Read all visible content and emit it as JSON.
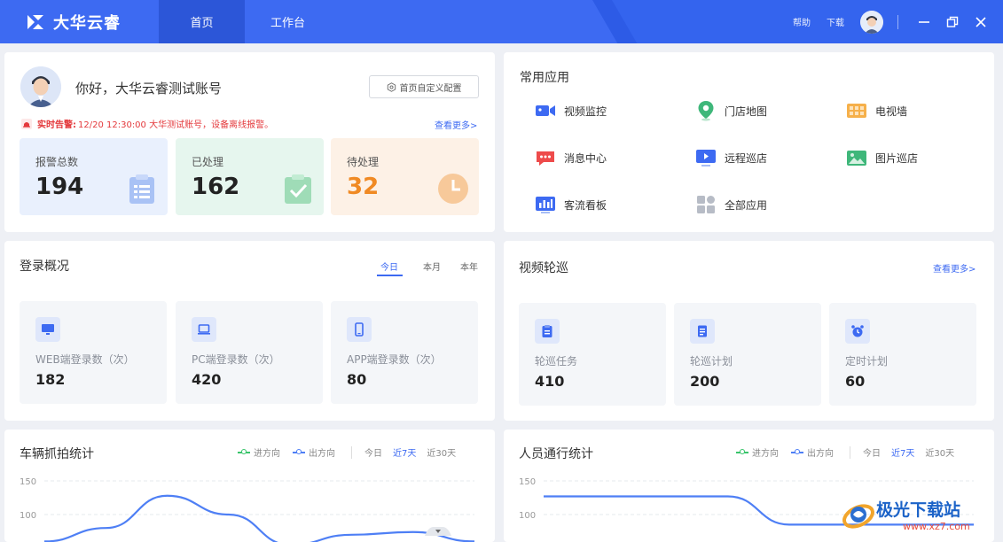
{
  "app": {
    "name": "大华云睿"
  },
  "nav": {
    "tabs": [
      {
        "label": "首页"
      },
      {
        "label": "工作台"
      }
    ]
  },
  "topbar": {
    "help": "帮助",
    "download": "下载"
  },
  "profile": {
    "greeting": "你好，大华云睿测试账号",
    "config_button": "首页自定义配置",
    "alarm_prefix": "实时告警:",
    "alarm_text": "12/20 12:30:00 大华测试账号，设备离线报警。",
    "more": "查看更多>"
  },
  "stats": [
    {
      "label": "报警总数",
      "value": "194"
    },
    {
      "label": "已处理",
      "value": "162"
    },
    {
      "label": "待处理",
      "value": "32"
    }
  ],
  "apps": {
    "title": "常用应用",
    "items": [
      {
        "label": "视频监控",
        "icon": "video-camera-icon"
      },
      {
        "label": "门店地图",
        "icon": "map-pin-icon"
      },
      {
        "label": "电视墙",
        "icon": "tv-wall-icon"
      },
      {
        "label": "消息中心",
        "icon": "message-icon"
      },
      {
        "label": "远程巡店",
        "icon": "remote-patrol-icon"
      },
      {
        "label": "图片巡店",
        "icon": "picture-icon"
      },
      {
        "label": "客流看板",
        "icon": "traffic-board-icon"
      },
      {
        "label": "全部应用",
        "icon": "grid-icon"
      }
    ]
  },
  "login": {
    "title": "登录概况",
    "tabs": [
      "今日",
      "本月",
      "本年"
    ],
    "tiles": [
      {
        "label": "WEB端登录数（次）",
        "value": "182",
        "icon": "monitor-icon"
      },
      {
        "label": "PC端登录数（次）",
        "value": "420",
        "icon": "laptop-icon"
      },
      {
        "label": "APP端登录数（次）",
        "value": "80",
        "icon": "phone-icon"
      }
    ]
  },
  "video": {
    "title": "视频轮巡",
    "more": "查看更多>",
    "tiles": [
      {
        "label": "轮巡任务",
        "value": "410",
        "icon": "task-icon"
      },
      {
        "label": "轮巡计划",
        "value": "200",
        "icon": "plan-icon"
      },
      {
        "label": "定时计划",
        "value": "60",
        "icon": "alarm-clock-icon"
      }
    ]
  },
  "vehicle": {
    "title": "车辆抓拍统计",
    "legend_in": "进方向",
    "legend_out": "出方向",
    "ranges": [
      "今日",
      "近7天",
      "近30天"
    ]
  },
  "person": {
    "title": "人员通行统计",
    "legend_in": "进方向",
    "legend_out": "出方向",
    "ranges": [
      "今日",
      "近7天",
      "近30天"
    ]
  },
  "chart_data": [
    {
      "type": "line",
      "title": "车辆抓拍统计",
      "yticks": [
        150,
        100
      ],
      "series": [
        {
          "name": "出方向",
          "color": "#4e7ff5",
          "values": [
            60,
            80,
            128,
            100,
            55,
            70,
            74,
            60
          ]
        }
      ]
    },
    {
      "type": "line",
      "title": "人员通行统计",
      "yticks": [
        150,
        100
      ],
      "series": [
        {
          "name": "出方向",
          "color": "#4e7ff5",
          "values": [
            127,
            127,
            127,
            127,
            85,
            85,
            85,
            85
          ]
        }
      ]
    }
  ],
  "watermark": {
    "text": "极光下载站",
    "url": "www.xz7.com"
  },
  "colors": {
    "brand": "#3d6af2",
    "alarm": "#e4393c",
    "pending": "#f08a24"
  }
}
